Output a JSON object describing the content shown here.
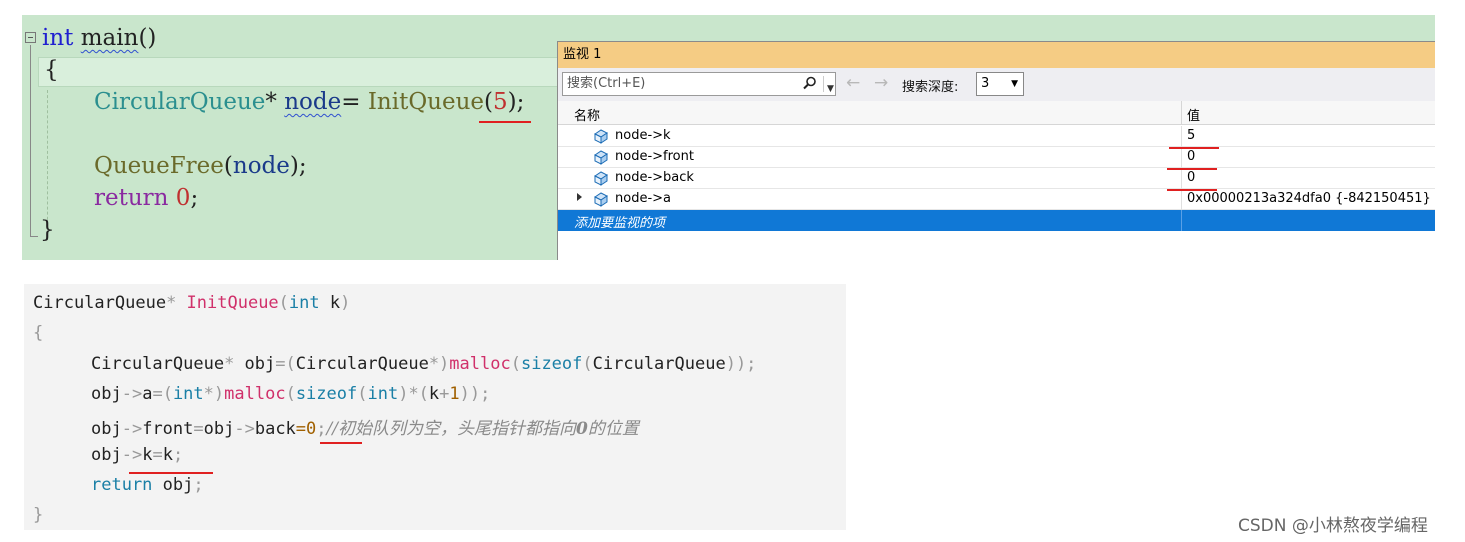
{
  "editor": {
    "line1": {
      "kw": "int",
      "fn": "main",
      "rest": "()"
    },
    "line2": "{",
    "line3": {
      "type": "CircularQueue",
      "star": "* ",
      "var": "node",
      "eq": "= ",
      "fn": "InitQueue",
      "open": "(",
      "num": "5",
      "close": ");"
    },
    "line4": {
      "fn": "QueueFree",
      "open": "(",
      "var": "node",
      "close": ");"
    },
    "line5": {
      "kw": "return",
      "num": "0",
      "semi": ";"
    },
    "line6": "}"
  },
  "watch": {
    "title": "监视 1",
    "search_placeholder": "搜索(Ctrl+E)",
    "depth_label": "搜索深度:",
    "depth_value": "3",
    "col_name": "名称",
    "col_value": "值",
    "rows": [
      {
        "name": "node->k",
        "value": "5"
      },
      {
        "name": "node->front",
        "value": "0"
      },
      {
        "name": "node->back",
        "value": "0"
      },
      {
        "name": "node->a",
        "value": "0x00000213a324dfa0 {-842150451}"
      }
    ],
    "add_item": "添加要监视的项"
  },
  "snippet": {
    "l1": {
      "type": "CircularQueue",
      "star": "* ",
      "fn": "InitQueue",
      "open": "(",
      "kw": "int",
      "arg": " k",
      "close": ")"
    },
    "l2": "{",
    "l3": {
      "a": "CircularQueue",
      "b": "* ",
      "c": "obj",
      "d": "=(",
      "e": "CircularQueue",
      "f": "*)",
      "g": "malloc",
      "h": "(",
      "i": "sizeof",
      "j": "(",
      "k": "CircularQueue",
      "l": "));"
    },
    "l4": {
      "a": "obj",
      "b": "->",
      "c": "a",
      "d": "=(",
      "e": "int",
      "f": "*)",
      "g": "malloc",
      "h": "(",
      "i": "sizeof",
      "j": "(",
      "k": "int",
      "l": ")*(",
      "m": "k",
      "n": "+",
      "o": "1",
      "p": "));"
    },
    "l5": {
      "a": "obj",
      "b": "->",
      "c": "front",
      "d": "=",
      "e": "obj",
      "f": "->",
      "g": "back",
      "h": "=",
      "i": "0",
      "j": ";",
      "cmt_a": "//初始队列为空，头尾指针都指向",
      "cmt_b": "0",
      "cmt_c": "的位置"
    },
    "l6": {
      "a": "obj",
      "b": "->",
      "c": "k",
      "d": "=",
      "e": "k",
      "f": ";"
    },
    "l7": {
      "kw": "return",
      "rest": " obj",
      "semi": ";"
    },
    "l8": "}"
  },
  "watermark": "CSDN @小林熬夜学编程"
}
